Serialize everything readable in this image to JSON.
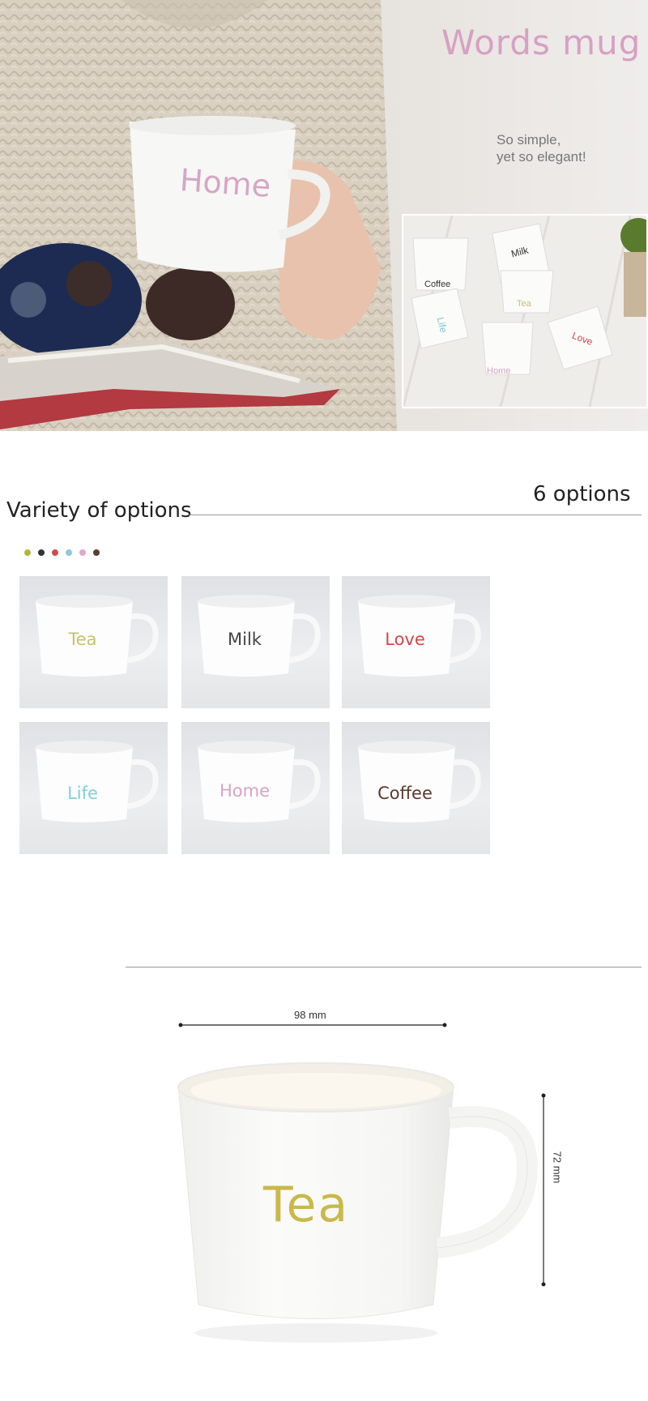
{
  "hero": {
    "title": "Words mug",
    "tagline_line1": "So simple,",
    "tagline_line2": "yet so elegant!",
    "mug_word": "Home",
    "collage_words": [
      "Coffee",
      "Milk",
      "Tea",
      "Life",
      "Home",
      "Love"
    ]
  },
  "options": {
    "title": "Variety of options",
    "count_label": "6 options",
    "swatch_colors": [
      "#b5b43c",
      "#333333",
      "#d24b4b",
      "#8ec8d8",
      "#e0a8c8",
      "#5a4030"
    ],
    "mugs": [
      {
        "word": "Tea",
        "color": "#c3c46a"
      },
      {
        "word": "Milk",
        "color": "#444444"
      },
      {
        "word": "Love",
        "color": "#d9454a"
      },
      {
        "word": "Life",
        "color": "#86cdd9"
      },
      {
        "word": "Home",
        "color": "#d8a3c6"
      },
      {
        "word": "Coffee",
        "color": "#5b3a30"
      }
    ]
  },
  "dimensions": {
    "width_label": "98 mm",
    "height_label": "72 mm",
    "mug_word": "Tea",
    "mug_word_color": "#c9b94a"
  }
}
